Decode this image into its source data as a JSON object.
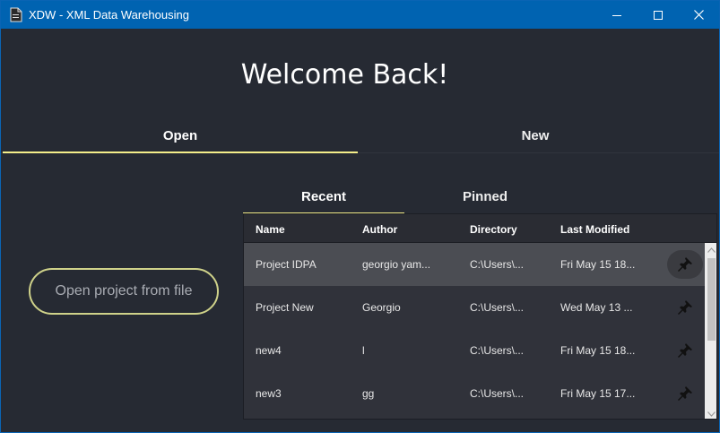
{
  "window": {
    "title": "XDW - XML Data Warehousing"
  },
  "header": {
    "welcome": "Welcome Back!"
  },
  "main_tabs": [
    {
      "label": "Open",
      "active": true
    },
    {
      "label": "New",
      "active": false
    }
  ],
  "open_file_button": "Open project from file",
  "sub_tabs": [
    {
      "label": "Recent",
      "active": true
    },
    {
      "label": "Pinned",
      "active": false
    }
  ],
  "table": {
    "columns": [
      "Name",
      "Author",
      "Directory",
      "Last Modified"
    ],
    "rows": [
      {
        "name": "Project IDPA",
        "author": "georgio yam...",
        "directory": "C:\\Users\\...",
        "modified": "Fri May 15 18...",
        "selected": true
      },
      {
        "name": "Project New",
        "author": "Georgio",
        "directory": "C:\\Users\\...",
        "modified": "Wed May 13 ...",
        "selected": false
      },
      {
        "name": "new4",
        "author": "l",
        "directory": "C:\\Users\\...",
        "modified": "Fri May 15 18...",
        "selected": false
      },
      {
        "name": "new3",
        "author": "gg",
        "directory": "C:\\Users\\...",
        "modified": "Fri May 15 17...",
        "selected": false
      }
    ]
  },
  "icons": {
    "app": "document-icon",
    "pin": "pushpin-icon",
    "minimize": "minimize-icon",
    "maximize": "maximize-icon",
    "close": "close-icon"
  },
  "colors": {
    "titlebar": "#0063b1",
    "background": "#262a33",
    "accent": "#f4ee8a",
    "button_border": "#cfd28a"
  }
}
